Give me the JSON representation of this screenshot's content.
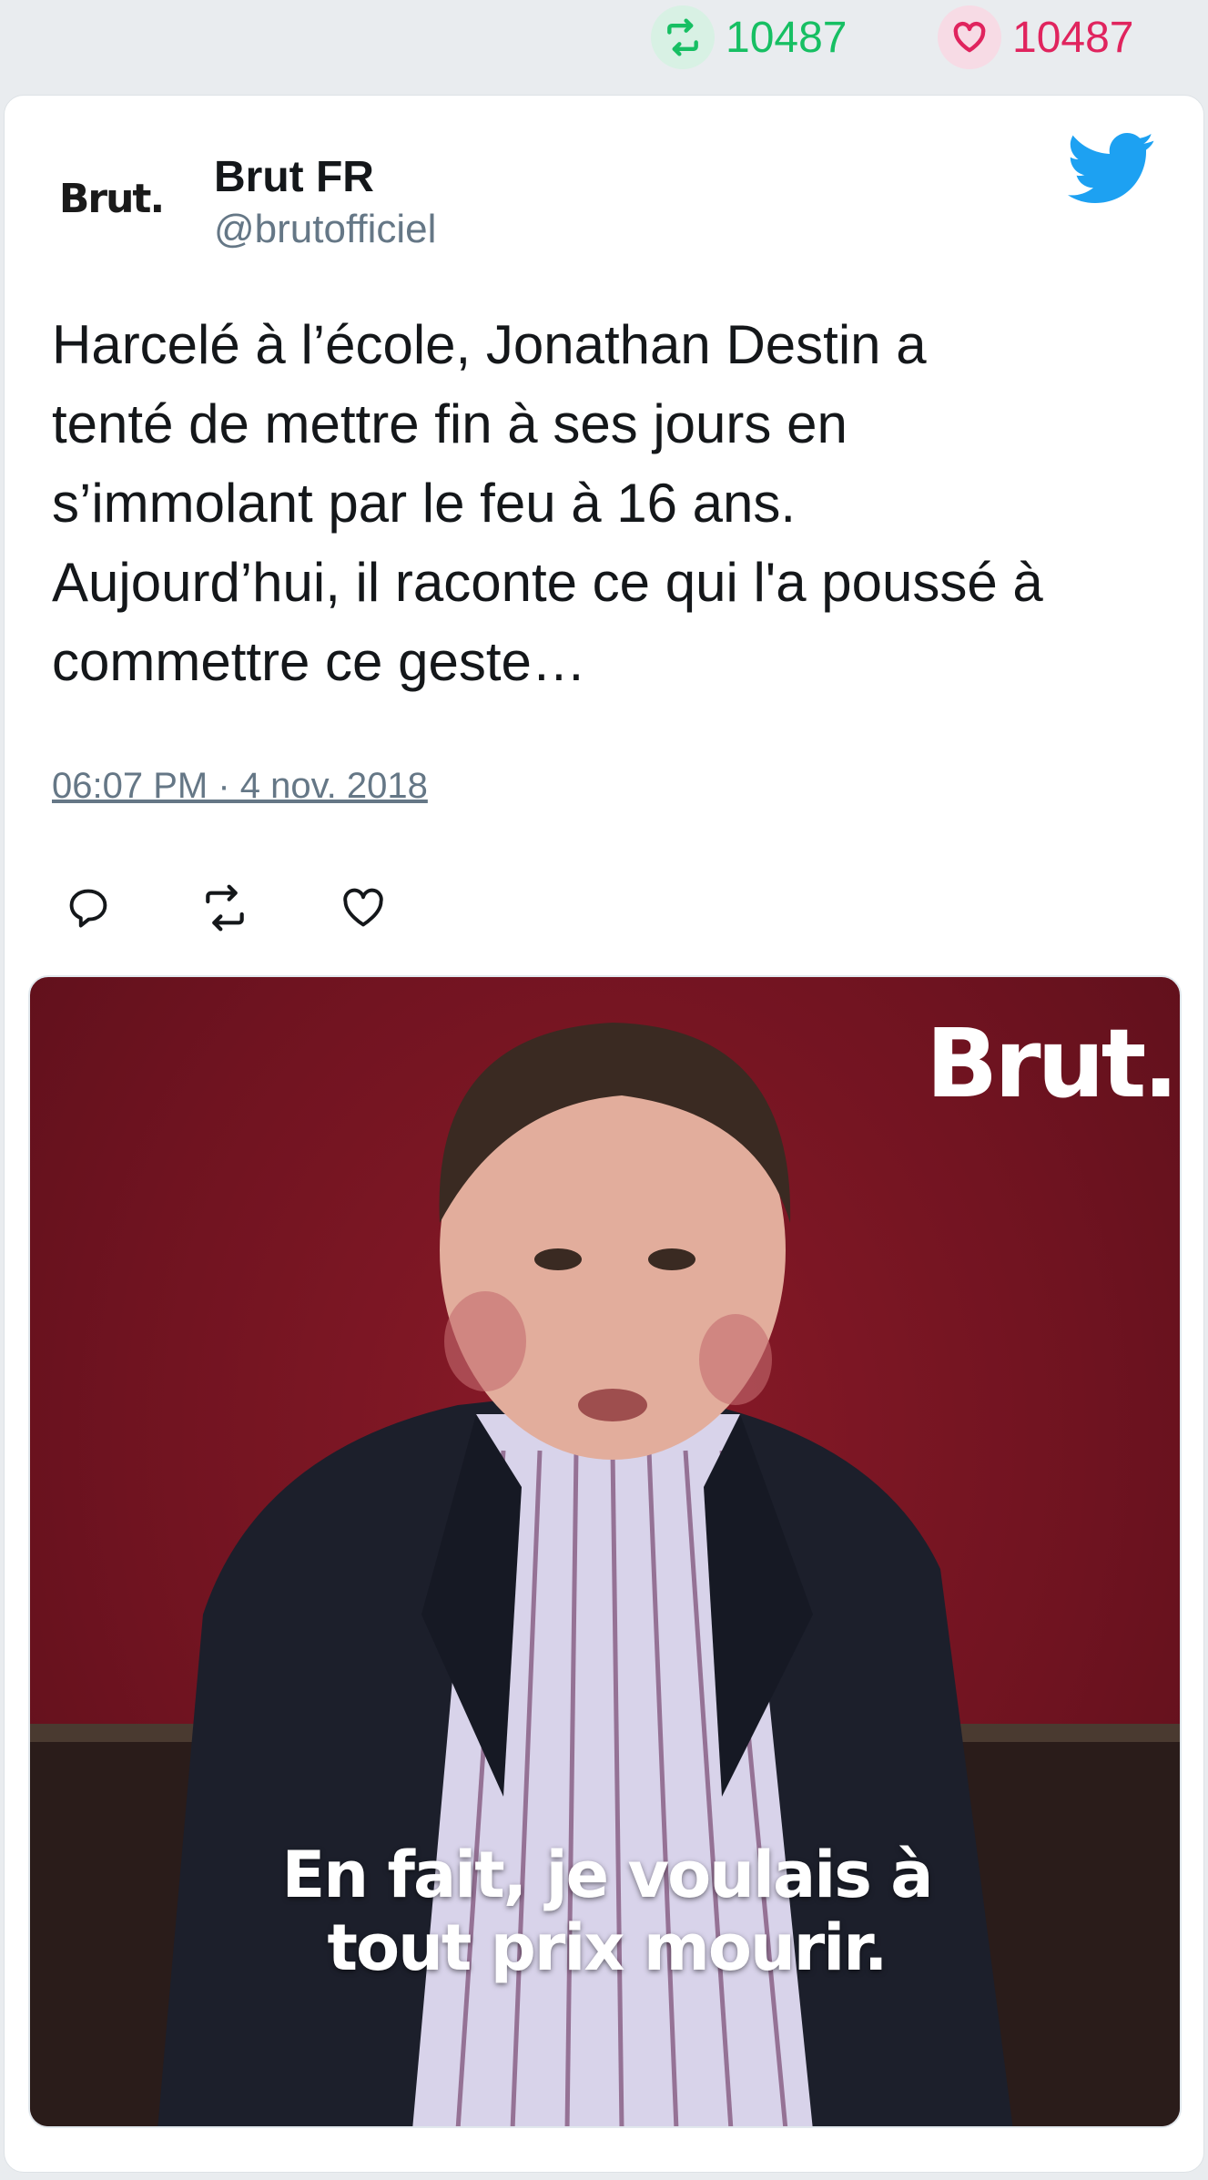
{
  "stats": {
    "retweets": "10487",
    "likes": "10487",
    "retweet_color": "#17bf63",
    "like_color": "#e0245e"
  },
  "tweet": {
    "author_name": "Brut FR",
    "author_handle": "@brutofficiel",
    "avatar_text": "Brut.",
    "text": "Harcelé à l’école, Jonathan Destin a\ntenté de mettre fin à ses jours en\ns’immolant par le feu à 16 ans.\nAujourd’hui, il raconte ce qui l'a poussé à\ncommettre ce geste…",
    "timestamp": "06:07 PM · 4 nov. 2018",
    "actions": [
      {
        "name": "reply",
        "icon": "reply-icon"
      },
      {
        "name": "retweet",
        "icon": "retweet-icon"
      },
      {
        "name": "like",
        "icon": "heart-icon"
      }
    ],
    "brand_icon": "twitter-bird-icon",
    "brand_color": "#1da1f2"
  },
  "media": {
    "logo_text": "Brut.",
    "caption_line1": "En fait, je voulais à",
    "caption_line2": "tout prix mourir."
  }
}
